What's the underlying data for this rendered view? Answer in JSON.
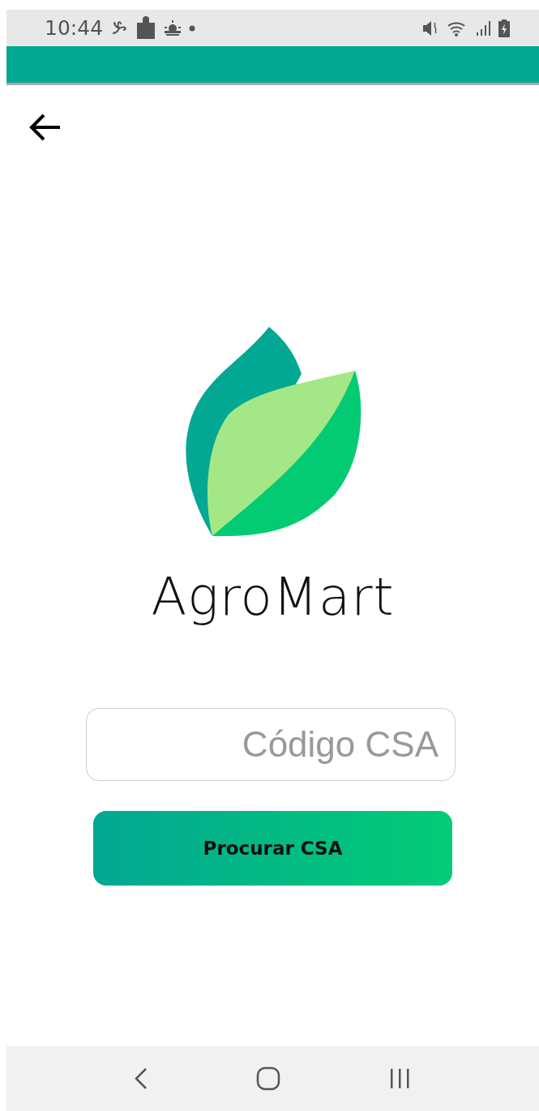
{
  "status_bar": {
    "time": "10:44"
  },
  "app_name": "AgroMart",
  "code_field": {
    "placeholder": "Código CSA"
  },
  "search_button": {
    "label": "Procurar CSA"
  }
}
